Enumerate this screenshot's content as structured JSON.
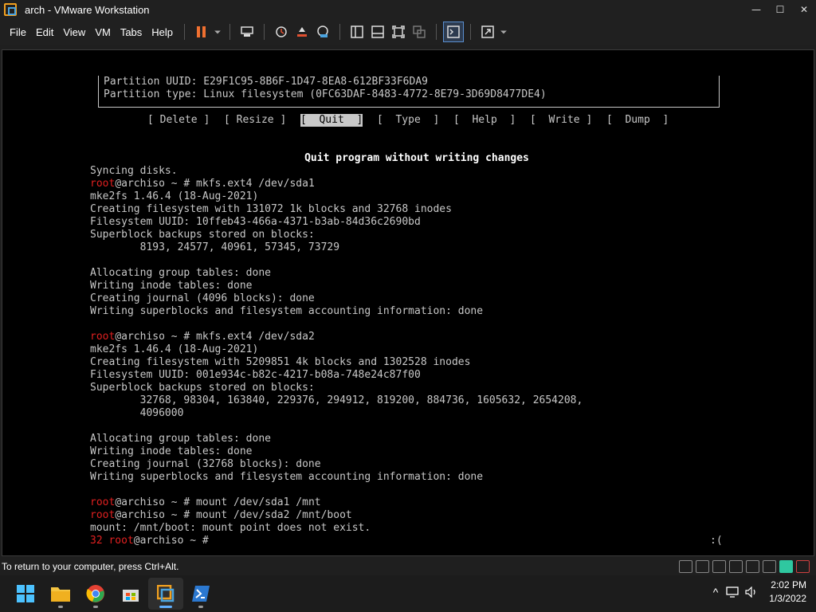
{
  "window": {
    "title": "arch - VMware Workstation",
    "minimize": "—",
    "maximize": "☐",
    "close": "✕"
  },
  "menu": {
    "file": "File",
    "edit": "Edit",
    "view": "View",
    "vm": "VM",
    "tabs": "Tabs",
    "help": "Help"
  },
  "tab": {
    "label": "arch",
    "close": "✕"
  },
  "console": {
    "partition_uuid": "Partition UUID: E29F1C95-8B6F-1D47-8EA8-612BF33F6DA9",
    "partition_type": "Partition type: Linux filesystem (0FC63DAF-8483-4772-8E79-3D69D8477DE4)",
    "actions": [
      "[ Delete ]",
      "[ Resize ]",
      "[  Quit  ]",
      "[  Type  ]",
      "[  Help  ]",
      "[  Write ]",
      "[  Dump  ]"
    ],
    "hint": "Quit program without writing changes",
    "lines": [
      {
        "prompt": "",
        "text": "Syncing disks."
      },
      {
        "prompt": "root",
        "text": "@archiso ~ # mkfs.ext4 /dev/sda1"
      },
      {
        "prompt": "",
        "text": "mke2fs 1.46.4 (18-Aug-2021)"
      },
      {
        "prompt": "",
        "text": "Creating filesystem with 131072 1k blocks and 32768 inodes"
      },
      {
        "prompt": "",
        "text": "Filesystem UUID: 10ffeb43-466a-4371-b3ab-84d36c2690bd"
      },
      {
        "prompt": "",
        "text": "Superblock backups stored on blocks:"
      },
      {
        "prompt": "",
        "text": "        8193, 24577, 40961, 57345, 73729"
      },
      {
        "prompt": "",
        "text": ""
      },
      {
        "prompt": "",
        "text": "Allocating group tables: done"
      },
      {
        "prompt": "",
        "text": "Writing inode tables: done"
      },
      {
        "prompt": "",
        "text": "Creating journal (4096 blocks): done"
      },
      {
        "prompt": "",
        "text": "Writing superblocks and filesystem accounting information: done"
      },
      {
        "prompt": "",
        "text": ""
      },
      {
        "prompt": "root",
        "text": "@archiso ~ # mkfs.ext4 /dev/sda2"
      },
      {
        "prompt": "",
        "text": "mke2fs 1.46.4 (18-Aug-2021)"
      },
      {
        "prompt": "",
        "text": "Creating filesystem with 5209851 4k blocks and 1302528 inodes"
      },
      {
        "prompt": "",
        "text": "Filesystem UUID: 001e934c-b82c-4217-b08a-748e24c87f00"
      },
      {
        "prompt": "",
        "text": "Superblock backups stored on blocks:"
      },
      {
        "prompt": "",
        "text": "        32768, 98304, 163840, 229376, 294912, 819200, 884736, 1605632, 2654208,"
      },
      {
        "prompt": "",
        "text": "        4096000"
      },
      {
        "prompt": "",
        "text": ""
      },
      {
        "prompt": "",
        "text": "Allocating group tables: done"
      },
      {
        "prompt": "",
        "text": "Writing inode tables: done"
      },
      {
        "prompt": "",
        "text": "Creating journal (32768 blocks): done"
      },
      {
        "prompt": "",
        "text": "Writing superblocks and filesystem accounting information: done"
      },
      {
        "prompt": "",
        "text": ""
      },
      {
        "prompt": "root",
        "text": "@archiso ~ # mount /dev/sda1 /mnt"
      },
      {
        "prompt": "root",
        "text": "@archiso ~ # mount /dev/sda2 /mnt/boot"
      },
      {
        "prompt": "",
        "text": "mount: /mnt/boot: mount point does not exist."
      },
      {
        "prompt": "32 root",
        "text": "@archiso ~ #"
      }
    ],
    "face": ":("
  },
  "status": {
    "message": "To return to your computer, press Ctrl+Alt."
  },
  "taskbar": {
    "time": "2:02 PM",
    "date": "1/3/2022",
    "tray_chevron": "^"
  }
}
